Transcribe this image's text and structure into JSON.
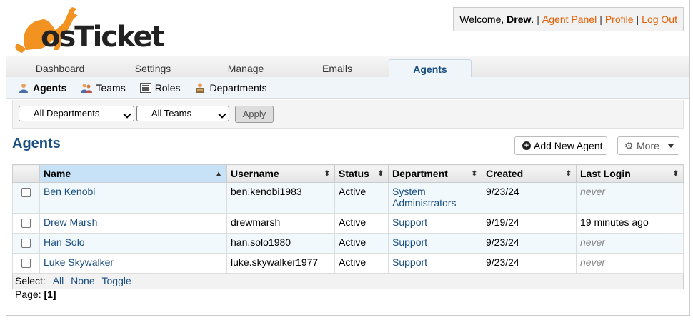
{
  "app": {
    "logo_text": "osTicket"
  },
  "header": {
    "welcome_prefix": "Welcome, ",
    "user": "Drew",
    "welcome_suffix": ".",
    "links": [
      "Agent Panel",
      "Profile",
      "Log Out"
    ]
  },
  "nav": {
    "tabs": [
      "Dashboard",
      "Settings",
      "Manage",
      "Emails",
      "Agents"
    ],
    "active_tab": "Agents"
  },
  "subnav": {
    "items": [
      "Agents",
      "Teams",
      "Roles",
      "Departments"
    ]
  },
  "filter": {
    "department": "— All Departments —",
    "team": "— All Teams —",
    "apply_label": "Apply"
  },
  "main": {
    "title": "Agents",
    "add_label": "Add New Agent",
    "more_label": "More"
  },
  "table": {
    "columns": [
      "Name",
      "Username",
      "Status",
      "Department",
      "Created",
      "Last Login"
    ],
    "rows": [
      {
        "name": "Ben Kenobi",
        "username": "ben.kenobi1983",
        "status": "Active",
        "department": "System Administrators",
        "created": "9/23/24",
        "last_login": "never"
      },
      {
        "name": "Drew Marsh",
        "username": "drewmarsh",
        "status": "Active",
        "department": "Support",
        "created": "9/19/24",
        "last_login": "19 minutes ago"
      },
      {
        "name": "Han Solo",
        "username": "han.solo1980",
        "status": "Active",
        "department": "Support",
        "created": "9/23/24",
        "last_login": "never"
      },
      {
        "name": "Luke Skywalker",
        "username": "luke.skywalker1977",
        "status": "Active",
        "department": "Support",
        "created": "9/23/24",
        "last_login": "never"
      }
    ],
    "select_label": "Select:",
    "select_links": [
      "All",
      "None",
      "Toggle"
    ]
  },
  "pager": {
    "label": "Page:",
    "current": "[1]"
  },
  "colors": {
    "brand_orange": "#e35d00",
    "link_blue": "#184e81"
  }
}
